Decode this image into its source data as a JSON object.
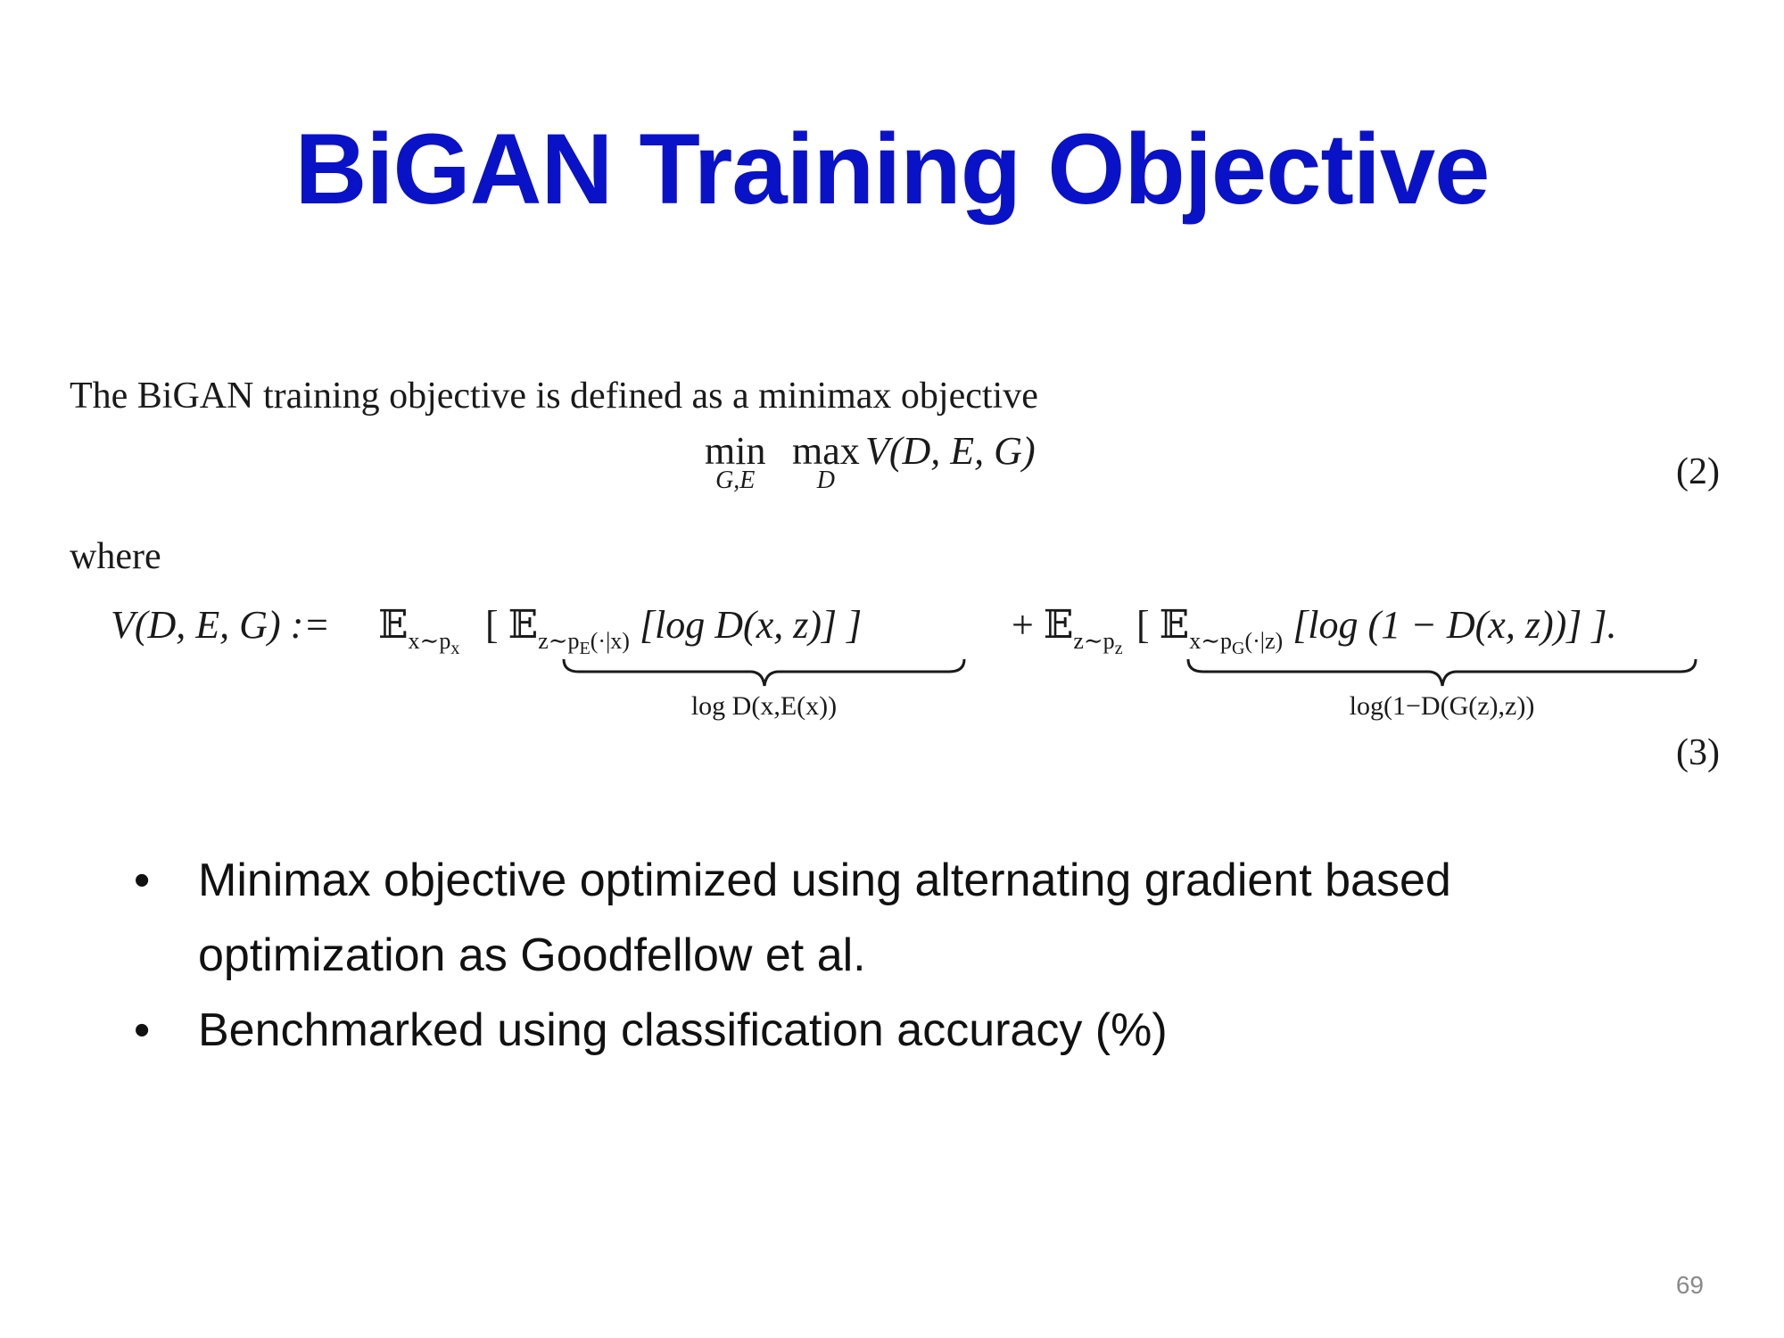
{
  "title": "BiGAN Training Objective",
  "paper_excerpt": {
    "intro": "The BiGAN training objective is defined as a minimax objective",
    "eq2": {
      "min_op": "min",
      "min_sub": "G,E",
      "max_op": "max",
      "max_sub": "D",
      "rest": "V(D, E, G)",
      "number": "(2)"
    },
    "where": "where",
    "eq3": {
      "lhs": "V(D, E, G) :=",
      "part1": "𝔼",
      "part1_sub": "x∼p",
      "part1_sub2": "x",
      "inner1": "[ 𝔼",
      "inner1_sub": "z∼p",
      "inner1_sub2": "E",
      "inner1_sub3": "(·|x)",
      "inner1_body": "[log D(x, z)] ]",
      "plus": "+ 𝔼",
      "part2_sub": "z∼p",
      "part2_sub2": "z",
      "inner2": "[ 𝔼",
      "inner2_sub": "x∼p",
      "inner2_sub2": "G",
      "inner2_sub3": "(·|z)",
      "inner2_body": "[log (1 − D(x, z))] ].",
      "brace1_label": "log D(x,E(x))",
      "brace2_label": "log(1−D(G(z),z))",
      "number": "(3)"
    }
  },
  "bullets": [
    {
      "text_line1": "Minimax objective optimized using alternating gradient based",
      "text_line2": "optimization as Goodfellow et al."
    },
    {
      "text_line1": "Benchmarked using classification accuracy (%)"
    }
  ],
  "bullet_glyph": "•",
  "page_number": "69",
  "colors": {
    "title": "#0a12c8",
    "page_number": "#8a8a8a"
  }
}
